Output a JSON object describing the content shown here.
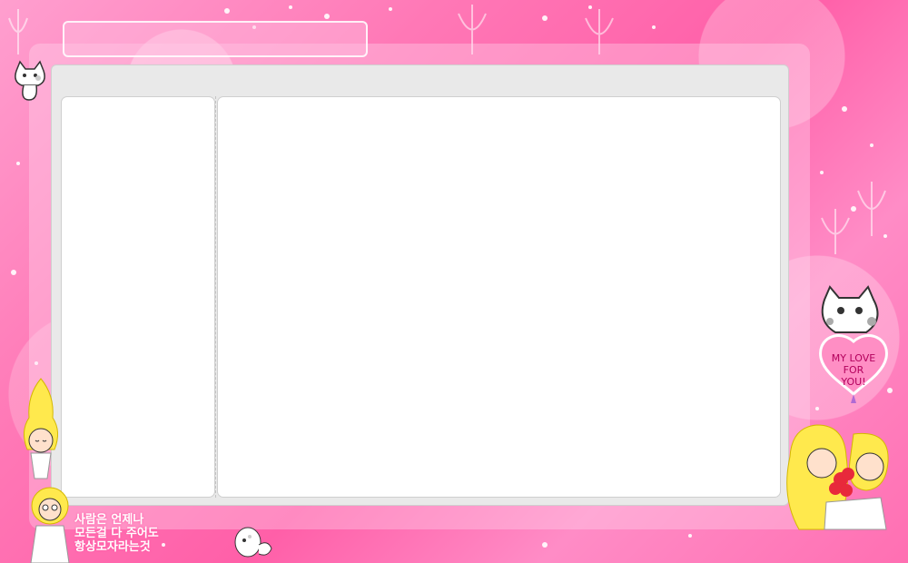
{
  "caption": {
    "line1": "사람은 언제나",
    "line2": "모든걸 다 주어도",
    "line3": "항상모자라는것"
  },
  "balloon": {
    "line1": "MY LOVE",
    "line2": "FOR",
    "line3": "YOU!"
  },
  "colors": {
    "background": "#ff78b6",
    "panel": "#e9e9e9",
    "pane": "#ffffff"
  }
}
